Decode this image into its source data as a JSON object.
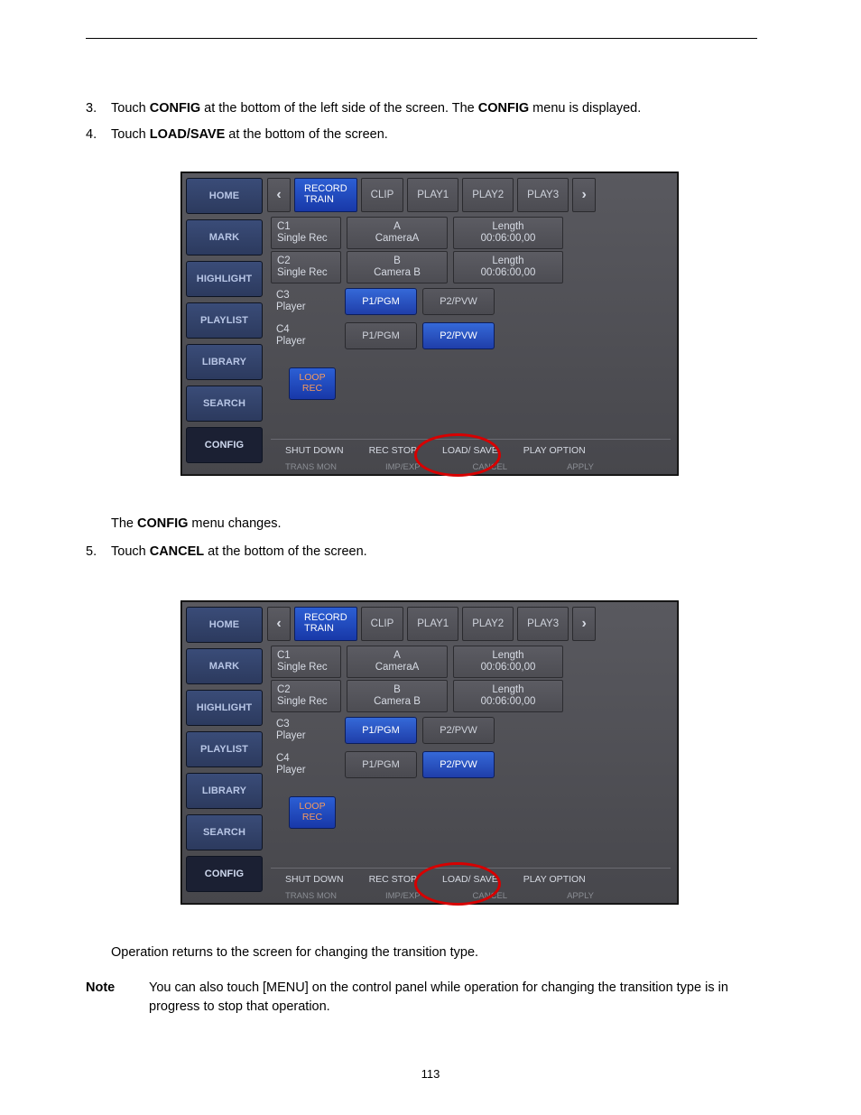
{
  "page_number": "113",
  "intro": {
    "step1_num": "3.",
    "step1_a": "Touch ",
    "step1_b": "CONFIG",
    "step1_c": " at the bottom of the left side of the screen. The ",
    "step1_d": "CONFIG",
    "step1_e": " menu is displayed.",
    "step2_num": "4.",
    "step2_a": "Touch ",
    "step2_b": "LOAD/SAVE",
    "step2_c": " at the bottom of the screen."
  },
  "mid": {
    "line1_a": "The ",
    "line1_b": "CONFIG",
    "line1_c": " menu changes.",
    "step5_num": "5.",
    "step5_a": "Touch ",
    "step5_b": "CANCEL",
    "step5_c": " at the bottom of the screen."
  },
  "after": {
    "line1": "Operation returns to the screen for changing the transition type.",
    "note_label": "Note",
    "note_body": "You can also touch [MENU] on the control panel while operation for changing the transition type is in progress to stop that operation."
  },
  "ui": {
    "sidebar": [
      "HOME",
      "MARK",
      "HIGHLIGHT",
      "PLAYLIST",
      "LIBRARY",
      "SEARCH",
      "CONFIG"
    ],
    "sidebar_selected": 6,
    "tabs": {
      "prev": "‹",
      "record": "RECORD\nTRAIN",
      "clip": "CLIP",
      "play1": "PLAY1",
      "play2": "PLAY2",
      "play3": "PLAY3",
      "next": "›",
      "active": 1
    },
    "rows": [
      {
        "ch": "C1",
        "mode": "Single Rec",
        "name1": "A",
        "name2": "CameraA",
        "len1": "Length",
        "len2": "00:06:00,00"
      },
      {
        "ch": "C2",
        "mode": "Single Rec",
        "name1": "B",
        "name2": "Camera B",
        "len1": "Length",
        "len2": "00:06:00,00"
      }
    ],
    "prows": [
      {
        "ch": "C3",
        "mode": "Player",
        "b1": "P1/PGM",
        "b2": "P2/PVW",
        "active": 0
      },
      {
        "ch": "C4",
        "mode": "Player",
        "b1": "P1/PGM",
        "b2": "P2/PVW",
        "active": 1
      }
    ],
    "loop": "LOOP\nREC",
    "bottom_top": [
      "SHUT DOWN",
      "REC STOP",
      "LOAD/ SAVE",
      "PLAY OPTION"
    ],
    "bottom_bot": [
      "TRANS MON",
      "IMP/EXP",
      "CANCEL",
      "APPLY"
    ]
  }
}
